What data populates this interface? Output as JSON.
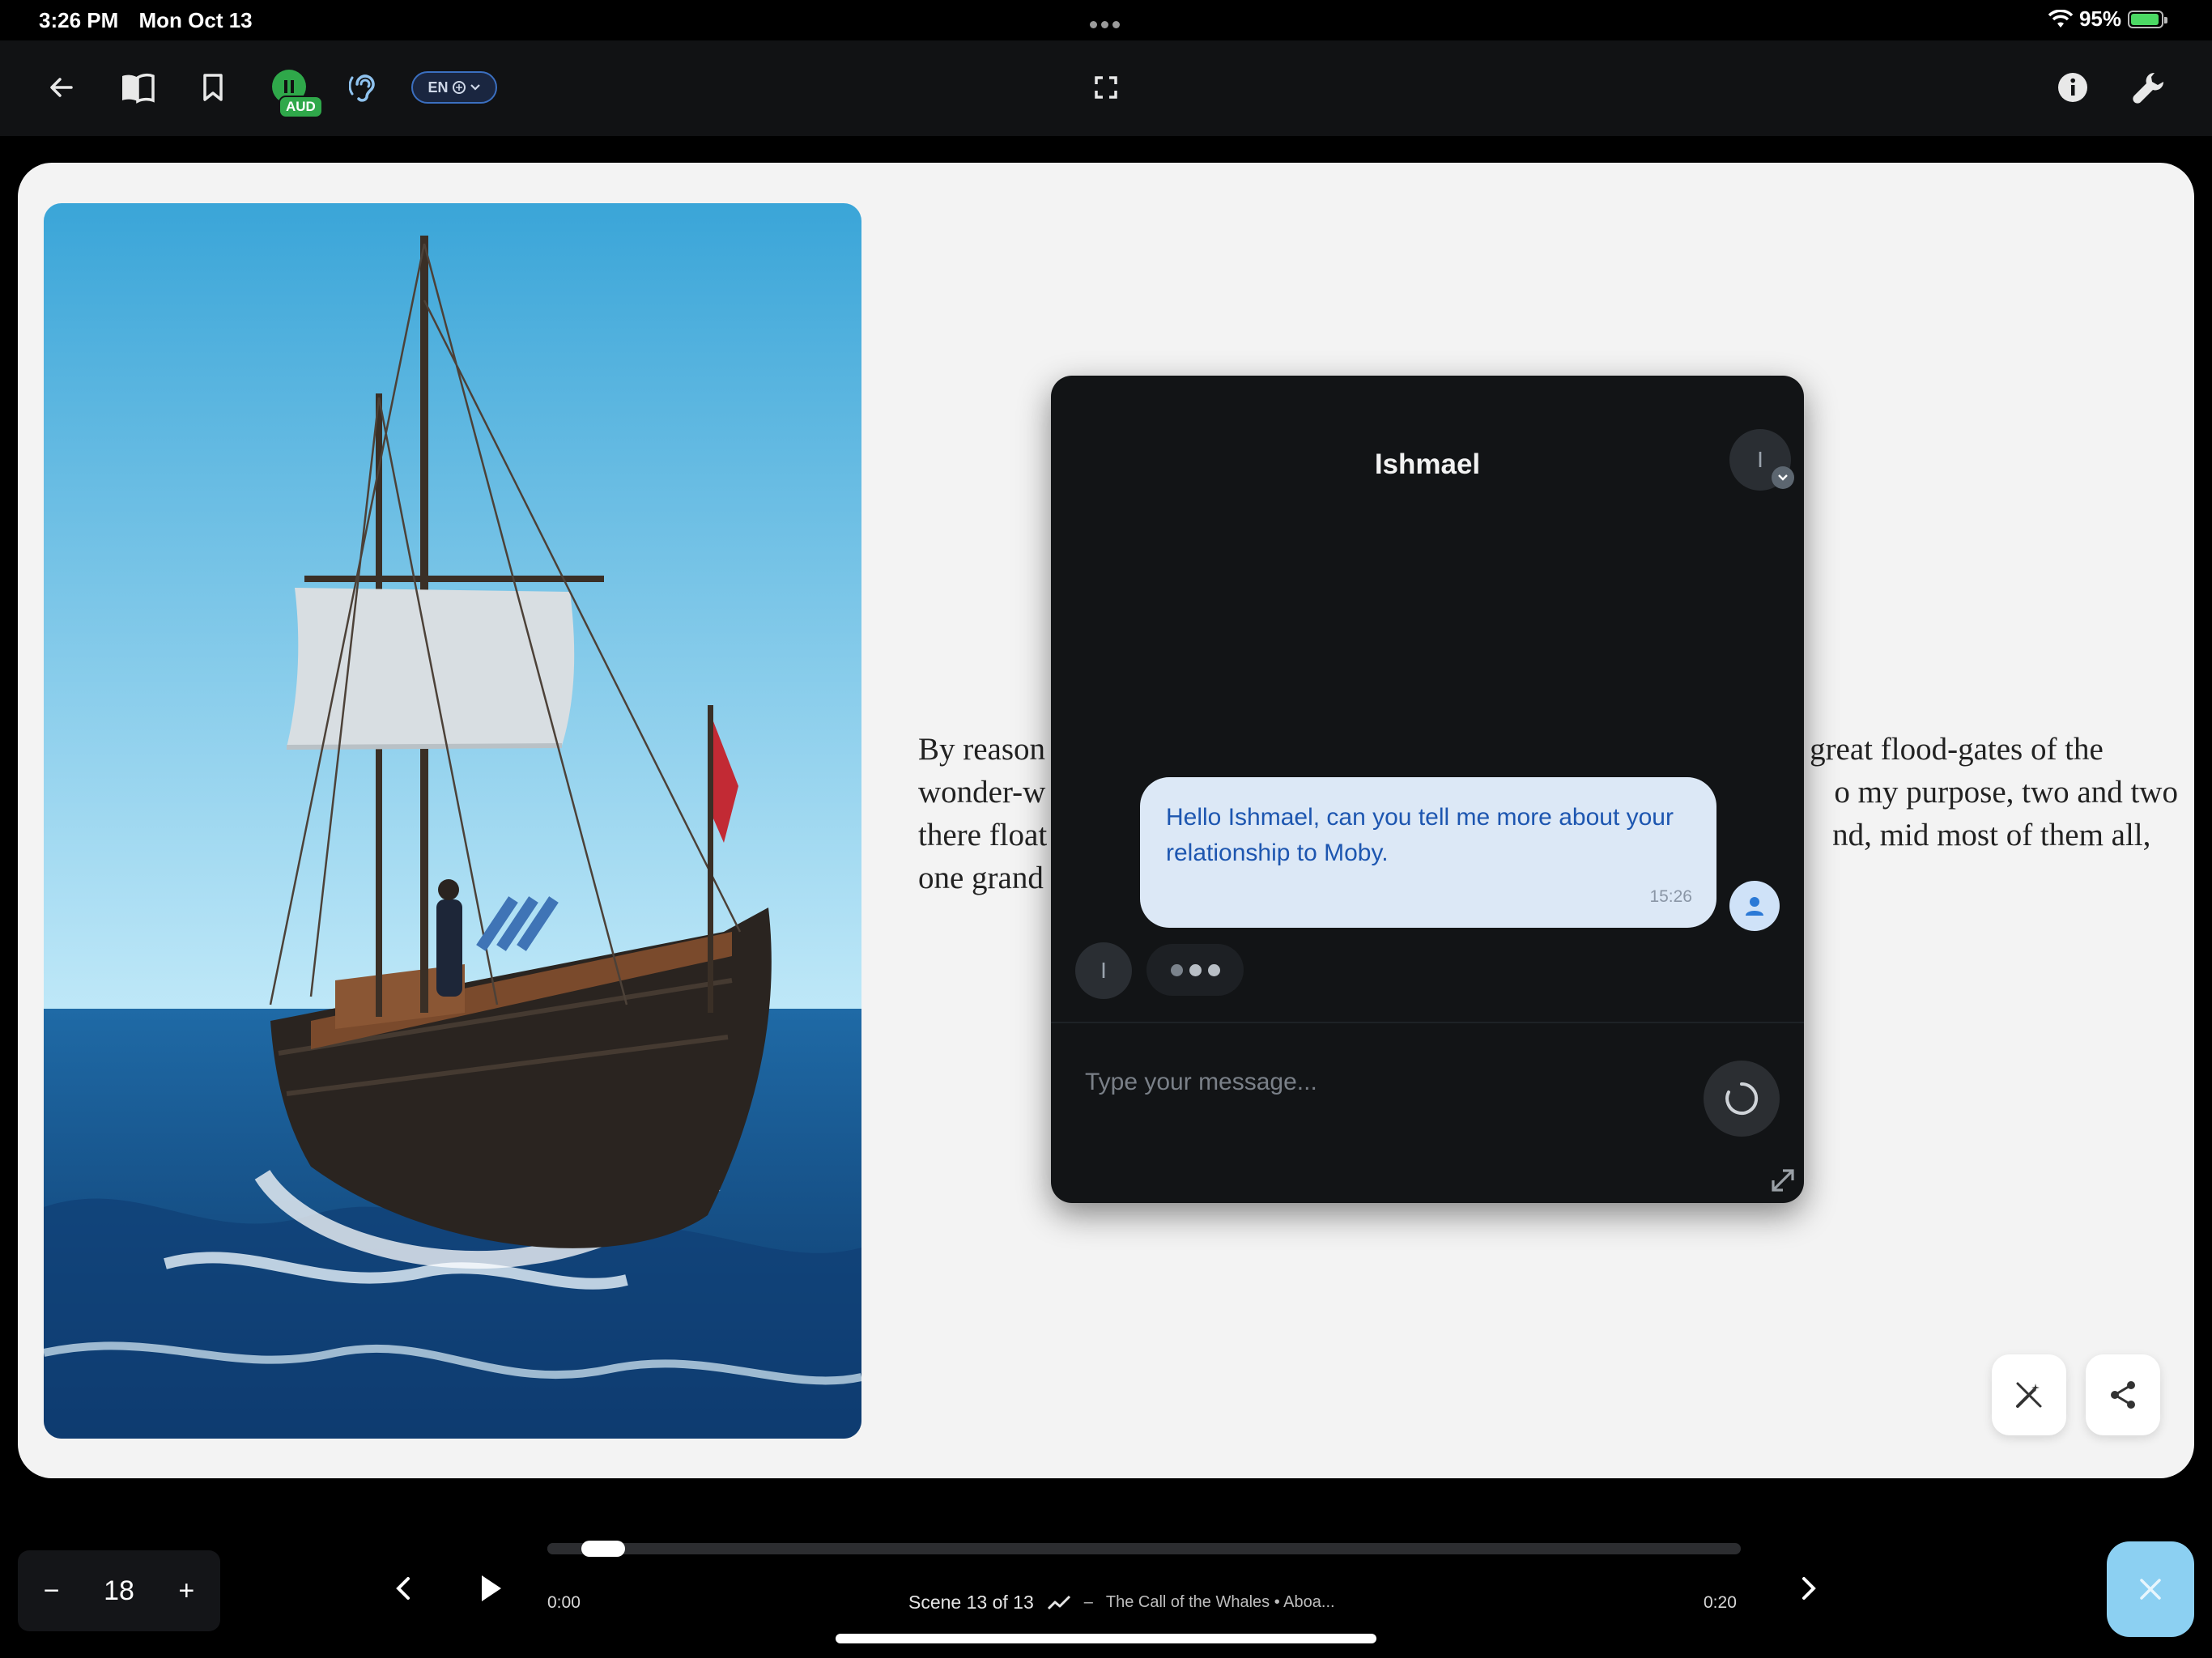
{
  "status_bar": {
    "time": "3:26 PM",
    "date": "Mon Oct 13",
    "battery": "95%",
    "battery_level": 0.95,
    "wifi_icon": "wifi-icon",
    "battery_icon": "battery-charging-icon"
  },
  "toolbar": {
    "back_icon": "arrow-left-icon",
    "library_icon": "open-book-icon",
    "bookmark_icon": "bookmark-icon",
    "audio_badge": "AUD",
    "listen_icon": "ear-icon",
    "language": "EN",
    "fullscreen_icon": "fullscreen-icon",
    "info_icon": "info-icon",
    "settings_icon": "wrench-icon"
  },
  "reader": {
    "passage_lines": [
      [
        "By reason",
        "great flood-gates of the"
      ],
      [
        "wonder-w",
        "o my purpose, two and two"
      ],
      [
        "there float",
        "nd, mid most of them all,"
      ],
      [
        "one grand",
        ""
      ]
    ],
    "magic_icon": "magic-wand-off-icon",
    "share_icon": "share-icon"
  },
  "chat": {
    "title": "Ishmael",
    "character_initial": "I",
    "user_message": "Hello Ishmael, can you tell me more about your relationship to Moby.",
    "message_time": "15:26",
    "input_placeholder": "Type your message...",
    "user_icon": "person-icon",
    "send_icon": "loading-spinner-icon",
    "expand_icon": "expand-icon"
  },
  "bottom_bar": {
    "font_size": "18",
    "minus_label": "−",
    "plus_label": "+",
    "time_start": "0:00",
    "time_end": "0:20",
    "progress": 0.035,
    "scene_label": "Scene 13 of 13",
    "chapter_label": "The Call of the Whales • Aboa...",
    "separator": "–",
    "close_icon": "close-icon"
  }
}
